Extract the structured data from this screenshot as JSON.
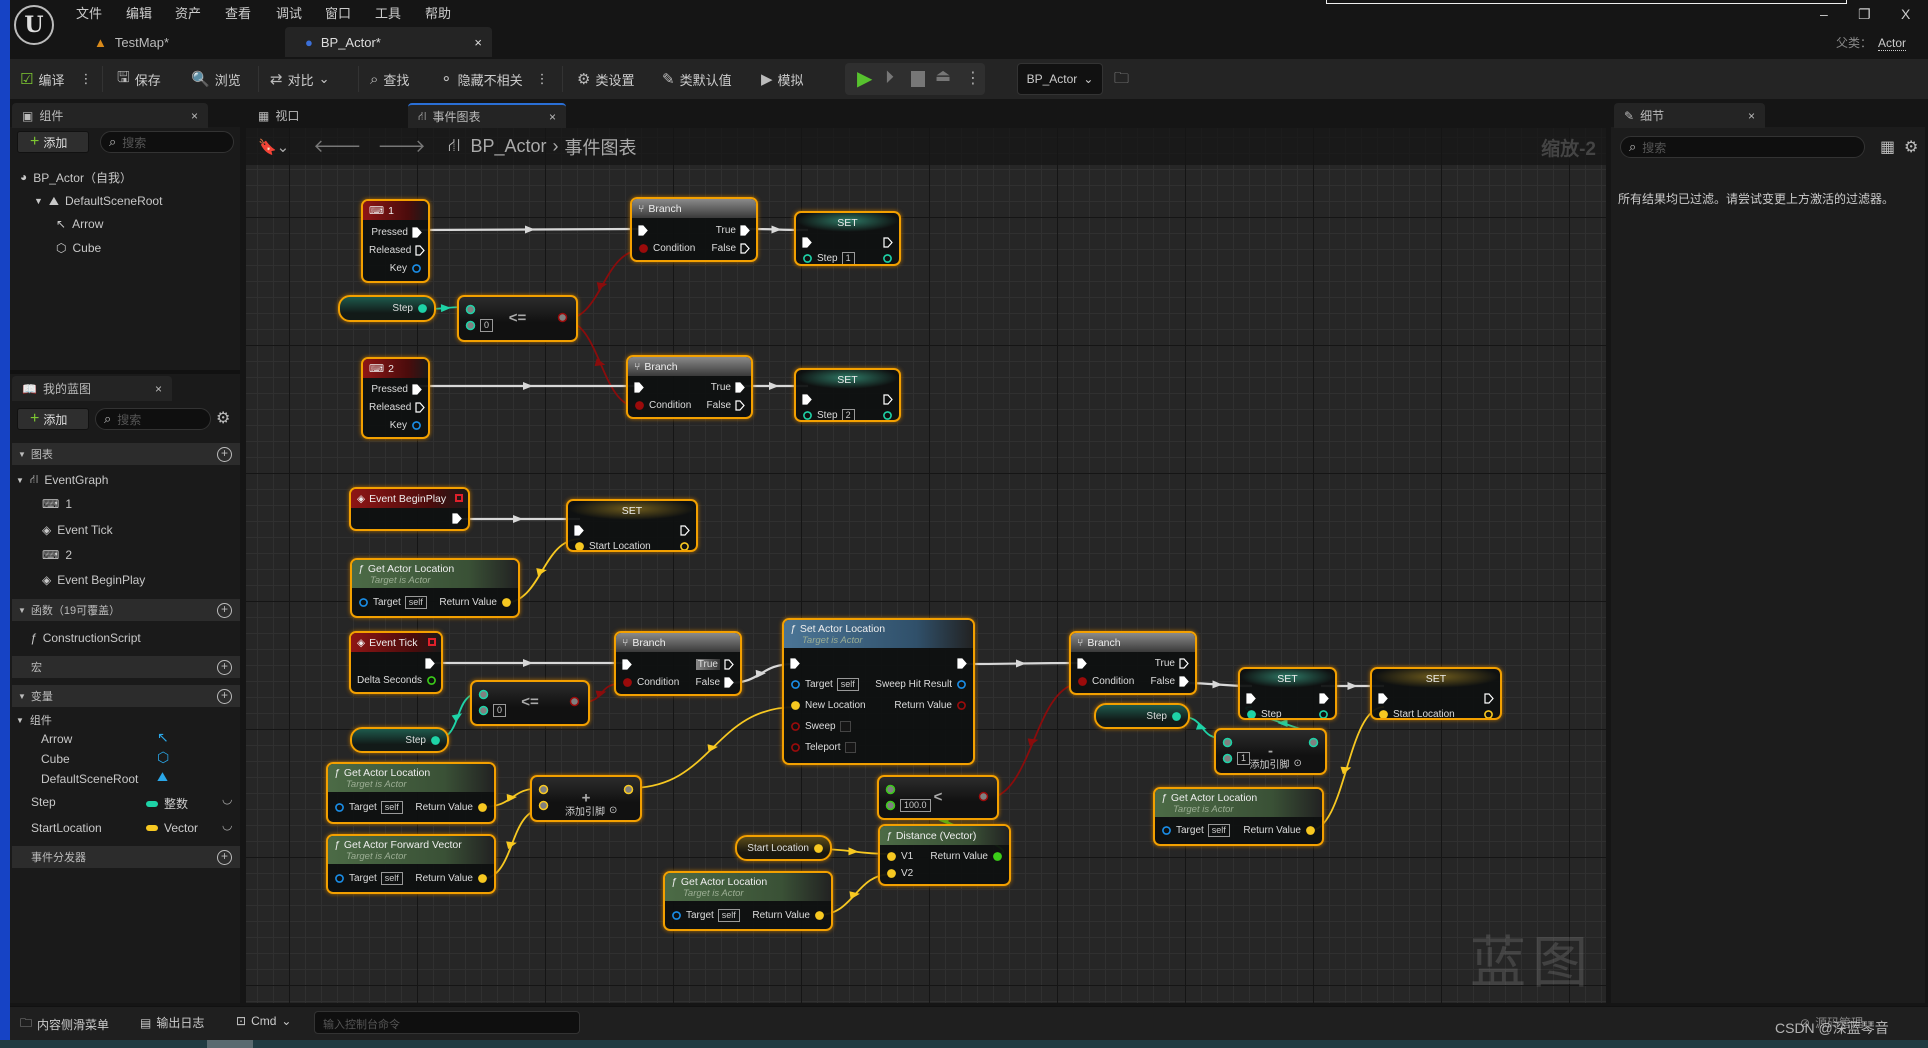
{
  "app": {
    "logo": "U",
    "menu": [
      "文件",
      "编辑",
      "资产",
      "查看",
      "调试",
      "窗口",
      "工具",
      "帮助"
    ],
    "tabs": [
      {
        "label": "TestMap*"
      },
      {
        "label": "BP_Actor*"
      }
    ],
    "parent_class_label": "父类：",
    "parent_class": "Actor",
    "window_controls": [
      "–",
      "❐",
      "X"
    ]
  },
  "toolbar": {
    "compile": "编译",
    "save": "保存",
    "browse": "浏览",
    "diff": "对比",
    "find": "查找",
    "hide_unrelated": "隐藏不相关",
    "class_settings": "类设置",
    "class_defaults": "类默认值",
    "simulate": "模拟",
    "debug_object": "BP_Actor"
  },
  "components_panel": {
    "title": "组件",
    "add": "添加",
    "search_placeholder": "搜索",
    "tree": [
      "BP_Actor（自我）",
      "DefaultSceneRoot",
      "Arrow",
      "Cube"
    ]
  },
  "editor_tabs": {
    "viewport": "视口",
    "event_graph": "事件图表"
  },
  "my_blueprint": {
    "title": "我的蓝图",
    "add": "添加",
    "search_placeholder": "搜索",
    "graphs_header": "图表",
    "event_graph": "EventGraph",
    "graph_items": [
      "1",
      "Event Tick",
      "2",
      "Event BeginPlay"
    ],
    "functions_header": "函数（19可覆盖）",
    "functions": [
      "ConstructionScript"
    ],
    "macros_header": "宏",
    "variables_header": "变量",
    "components_group": "组件",
    "component_vars": [
      "Arrow",
      "Cube",
      "DefaultSceneRoot"
    ],
    "variables": [
      {
        "name": "Step",
        "type": "整数",
        "color": "#1ed3a7"
      },
      {
        "name": "StartLocation",
        "type": "Vector",
        "color": "#f7c821"
      }
    ],
    "dispatchers_header": "事件分发器"
  },
  "graph": {
    "breadcrumb": [
      "BP_Actor",
      "事件图表"
    ],
    "zoom": "缩放-2",
    "watermark": "蓝图",
    "pin_colors": {
      "exec": "#ffffff",
      "int": "#1ed3a7",
      "bool": "#9b0b0b",
      "vec": "#f7c821",
      "obj": "#1a8ee8",
      "float": "#3bcd19"
    },
    "nodes": [
      {
        "id": "key1",
        "type": "key",
        "title": "1",
        "rows": [
          [
            null,
            {
              "label": "Pressed",
              "type": "exec",
              "filled": true
            }
          ],
          [
            null,
            {
              "label": "Released",
              "type": "exec"
            }
          ],
          [
            null,
            {
              "label": "Key",
              "type": "obj"
            }
          ]
        ]
      },
      {
        "id": "branch1",
        "type": "branch",
        "title": "Branch",
        "rows": [
          [
            {
              "type": "exec",
              "filled": true
            },
            {
              "label": "True",
              "type": "exec",
              "filled": true
            }
          ],
          [
            {
              "label": "Condition",
              "type": "bool",
              "filled": true
            },
            {
              "label": "False",
              "type": "exec"
            }
          ]
        ]
      },
      {
        "id": "set1",
        "type": "set_int",
        "title": "SET",
        "rows": [
          [
            {
              "type": "exec",
              "filled": true
            },
            {
              "type": "exec"
            }
          ],
          [
            {
              "label": "Step",
              "type": "int",
              "value": "1"
            },
            {
              "type": "int"
            }
          ]
        ]
      },
      {
        "id": "step1",
        "type": "getter_int",
        "rows": [
          [
            null,
            {
              "label": "Step",
              "type": "int",
              "filled": true
            }
          ]
        ]
      },
      {
        "id": "le1",
        "type": "op",
        "op": "<=",
        "rows": [
          [
            {
              "type": "int",
              "op": true
            },
            null
          ],
          [
            {
              "type": "int",
              "op": true,
              "value": "0"
            },
            null
          ]
        ],
        "out": {
          "type": "bool",
          "op": true
        }
      },
      {
        "id": "key2",
        "type": "key",
        "title": "2",
        "rows": [
          [
            null,
            {
              "label": "Pressed",
              "type": "exec",
              "filled": true
            }
          ],
          [
            null,
            {
              "label": "Released",
              "type": "exec"
            }
          ],
          [
            null,
            {
              "label": "Key",
              "type": "obj"
            }
          ]
        ]
      },
      {
        "id": "branch2",
        "type": "branch",
        "title": "Branch",
        "rows": [
          [
            {
              "type": "exec",
              "filled": true
            },
            {
              "label": "True",
              "type": "exec",
              "filled": true
            }
          ],
          [
            {
              "label": "Condition",
              "type": "bool",
              "filled": true
            },
            {
              "label": "False",
              "type": "exec"
            }
          ]
        ]
      },
      {
        "id": "set2",
        "type": "set_int",
        "title": "SET",
        "rows": [
          [
            {
              "type": "exec",
              "filled": true
            },
            {
              "type": "exec"
            }
          ],
          [
            {
              "label": "Step",
              "type": "int",
              "value": "2"
            },
            {
              "type": "int"
            }
          ]
        ]
      },
      {
        "id": "beginplay",
        "type": "event",
        "title": "Event BeginPlay",
        "rows": [
          [
            null,
            {
              "type": "exec",
              "filled": true
            }
          ]
        ]
      },
      {
        "id": "set_sl1",
        "type": "set_vec",
        "title": "SET",
        "rows": [
          [
            {
              "type": "exec",
              "filled": true
            },
            {
              "type": "exec"
            }
          ],
          [
            {
              "label": "Start Location",
              "type": "vec",
              "filled": true
            },
            {
              "type": "vec"
            }
          ]
        ]
      },
      {
        "id": "gal_a",
        "type": "func",
        "title": "Get Actor Location",
        "subtitle": "Target is Actor",
        "rows": [
          [
            {
              "label": "Target",
              "type": "obj",
              "value": "self"
            },
            {
              "label": "Return Value",
              "type": "vec",
              "filled": true
            }
          ]
        ]
      },
      {
        "id": "tick",
        "type": "event",
        "title": "Event Tick",
        "rows": [
          [
            null,
            {
              "type": "exec",
              "filled": true
            }
          ],
          [
            null,
            {
              "label": "Delta Seconds",
              "type": "float"
            }
          ]
        ]
      },
      {
        "id": "branch3",
        "type": "branch",
        "title": "Branch",
        "rows": [
          [
            {
              "type": "exec",
              "filled": true
            },
            {
              "label": "True",
              "type": "exec",
              "hover": true
            }
          ],
          [
            {
              "label": "Condition",
              "type": "bool",
              "filled": true
            },
            {
              "label": "False",
              "type": "exec",
              "filled": true
            }
          ]
        ]
      },
      {
        "id": "le2",
        "type": "op",
        "op": "<=",
        "rows": [
          [
            {
              "type": "int",
              "op": true
            },
            null
          ],
          [
            {
              "type": "int",
              "op": true,
              "value": "0"
            },
            null
          ]
        ],
        "out": {
          "type": "bool",
          "op": true
        }
      },
      {
        "id": "step2",
        "type": "getter_int",
        "rows": [
          [
            null,
            {
              "label": "Step",
              "type": "int",
              "filled": true
            }
          ]
        ]
      },
      {
        "id": "sal",
        "type": "func_set",
        "title": "Set Actor Location",
        "subtitle": "Target is Actor",
        "rows": [
          [
            {
              "type": "exec",
              "filled": true
            },
            {
              "type": "exec",
              "filled": true
            }
          ],
          [
            {
              "label": "Target",
              "type": "obj",
              "value": "self"
            },
            {
              "label": "Sweep Hit Result",
              "type": "obj"
            }
          ],
          [
            {
              "label": "New Location",
              "type": "vec",
              "filled": true
            },
            {
              "label": "Return Value",
              "type": "bool"
            }
          ],
          [
            {
              "label": "Sweep",
              "type": "bool",
              "checkbox": true
            },
            null
          ],
          [
            {
              "label": "Teleport",
              "type": "bool",
              "checkbox": true
            },
            null
          ]
        ]
      },
      {
        "id": "gal_b",
        "type": "func",
        "title": "Get Actor Location",
        "subtitle": "Target is Actor",
        "rows": [
          [
            {
              "label": "Target",
              "type": "obj",
              "value": "self"
            },
            {
              "label": "Return Value",
              "type": "vec",
              "filled": true
            }
          ]
        ]
      },
      {
        "id": "add",
        "type": "op",
        "op": "+",
        "add_pin": "添加引脚",
        "rows": [
          [
            {
              "type": "vec",
              "op": true
            },
            {
              "type": "vec",
              "op": true
            }
          ],
          [
            {
              "type": "vec",
              "op": true
            },
            null
          ]
        ]
      },
      {
        "id": "gafv",
        "type": "func",
        "title": "Get Actor Forward Vector",
        "subtitle": "Target is Actor",
        "rows": [
          [
            {
              "label": "Target",
              "type": "obj",
              "value": "self"
            },
            {
              "label": "Return Value",
              "type": "vec",
              "filled": true
            }
          ]
        ]
      },
      {
        "id": "lt",
        "type": "op",
        "op": "<",
        "rows": [
          [
            {
              "type": "float",
              "op": true
            },
            null
          ],
          [
            {
              "type": "float",
              "op": true,
              "value": "100.0"
            },
            null
          ]
        ],
        "out": {
          "type": "bool",
          "op": true
        }
      },
      {
        "id": "sl_get",
        "type": "getter_vec",
        "rows": [
          [
            null,
            {
              "label": "Start Location",
              "type": "vec",
              "filled": true
            }
          ]
        ]
      },
      {
        "id": "dist",
        "type": "func",
        "title": "Distance (Vector)",
        "rows": [
          [
            {
              "label": "V1",
              "type": "vec",
              "filled": true
            },
            {
              "label": "Return Value",
              "type": "float",
              "filled": true
            }
          ],
          [
            {
              "label": "V2",
              "type": "vec",
              "filled": true
            },
            null
          ]
        ]
      },
      {
        "id": "gal_c",
        "type": "func",
        "title": "Get Actor Location",
        "subtitle": "Target is Actor",
        "rows": [
          [
            {
              "label": "Target",
              "type": "obj",
              "value": "self"
            },
            {
              "label": "Return Value",
              "type": "vec",
              "filled": true
            }
          ]
        ]
      },
      {
        "id": "branch4",
        "type": "branch",
        "title": "Branch",
        "rows": [
          [
            {
              "type": "exec",
              "filled": true
            },
            {
              "label": "True",
              "type": "exec"
            }
          ],
          [
            {
              "label": "Condition",
              "type": "bool",
              "filled": true
            },
            {
              "label": "False",
              "type": "exec",
              "filled": true
            }
          ]
        ]
      },
      {
        "id": "set_step",
        "type": "set_int",
        "title": "SET",
        "rows": [
          [
            {
              "type": "exec",
              "filled": true
            },
            {
              "type": "exec",
              "filled": true
            }
          ],
          [
            {
              "label": "Step",
              "type": "int",
              "filled": true
            },
            {
              "type": "int"
            }
          ]
        ]
      },
      {
        "id": "step3",
        "type": "getter_int",
        "rows": [
          [
            null,
            {
              "label": "Step",
              "type": "int",
              "filled": true
            }
          ]
        ]
      },
      {
        "id": "sub",
        "type": "op",
        "op": "-",
        "add_pin": "添加引脚",
        "rows": [
          [
            {
              "type": "int",
              "op": true
            },
            {
              "type": "int",
              "op": true
            }
          ],
          [
            {
              "type": "int",
              "op": true,
              "value": "1"
            },
            null
          ]
        ]
      },
      {
        "id": "set_sl2",
        "type": "set_vec",
        "title": "SET",
        "rows": [
          [
            {
              "type": "exec",
              "filled": true
            },
            {
              "type": "exec"
            }
          ],
          [
            {
              "label": "Start Location",
              "type": "vec",
              "filled": true
            },
            {
              "type": "vec"
            }
          ]
        ]
      },
      {
        "id": "gal_d",
        "type": "func",
        "title": "Get Actor Location",
        "subtitle": "Target is Actor",
        "rows": [
          [
            {
              "label": "Target",
              "type": "obj",
              "value": "self"
            },
            {
              "label": "Return Value",
              "type": "vec",
              "filled": true
            }
          ]
        ]
      }
    ]
  },
  "details_panel": {
    "title": "细节",
    "search_placeholder": "搜索",
    "message": "所有结果均已过滤。请尝试变更上方激活的过滤器。"
  },
  "statusbar": {
    "content_drawer": "内容侧滑菜单",
    "output_log": "输出日志",
    "cmd": "Cmd",
    "console_placeholder": "输入控制台命令",
    "source_control": "源码管理",
    "watermark": "CSDN @深蓝琴音"
  }
}
